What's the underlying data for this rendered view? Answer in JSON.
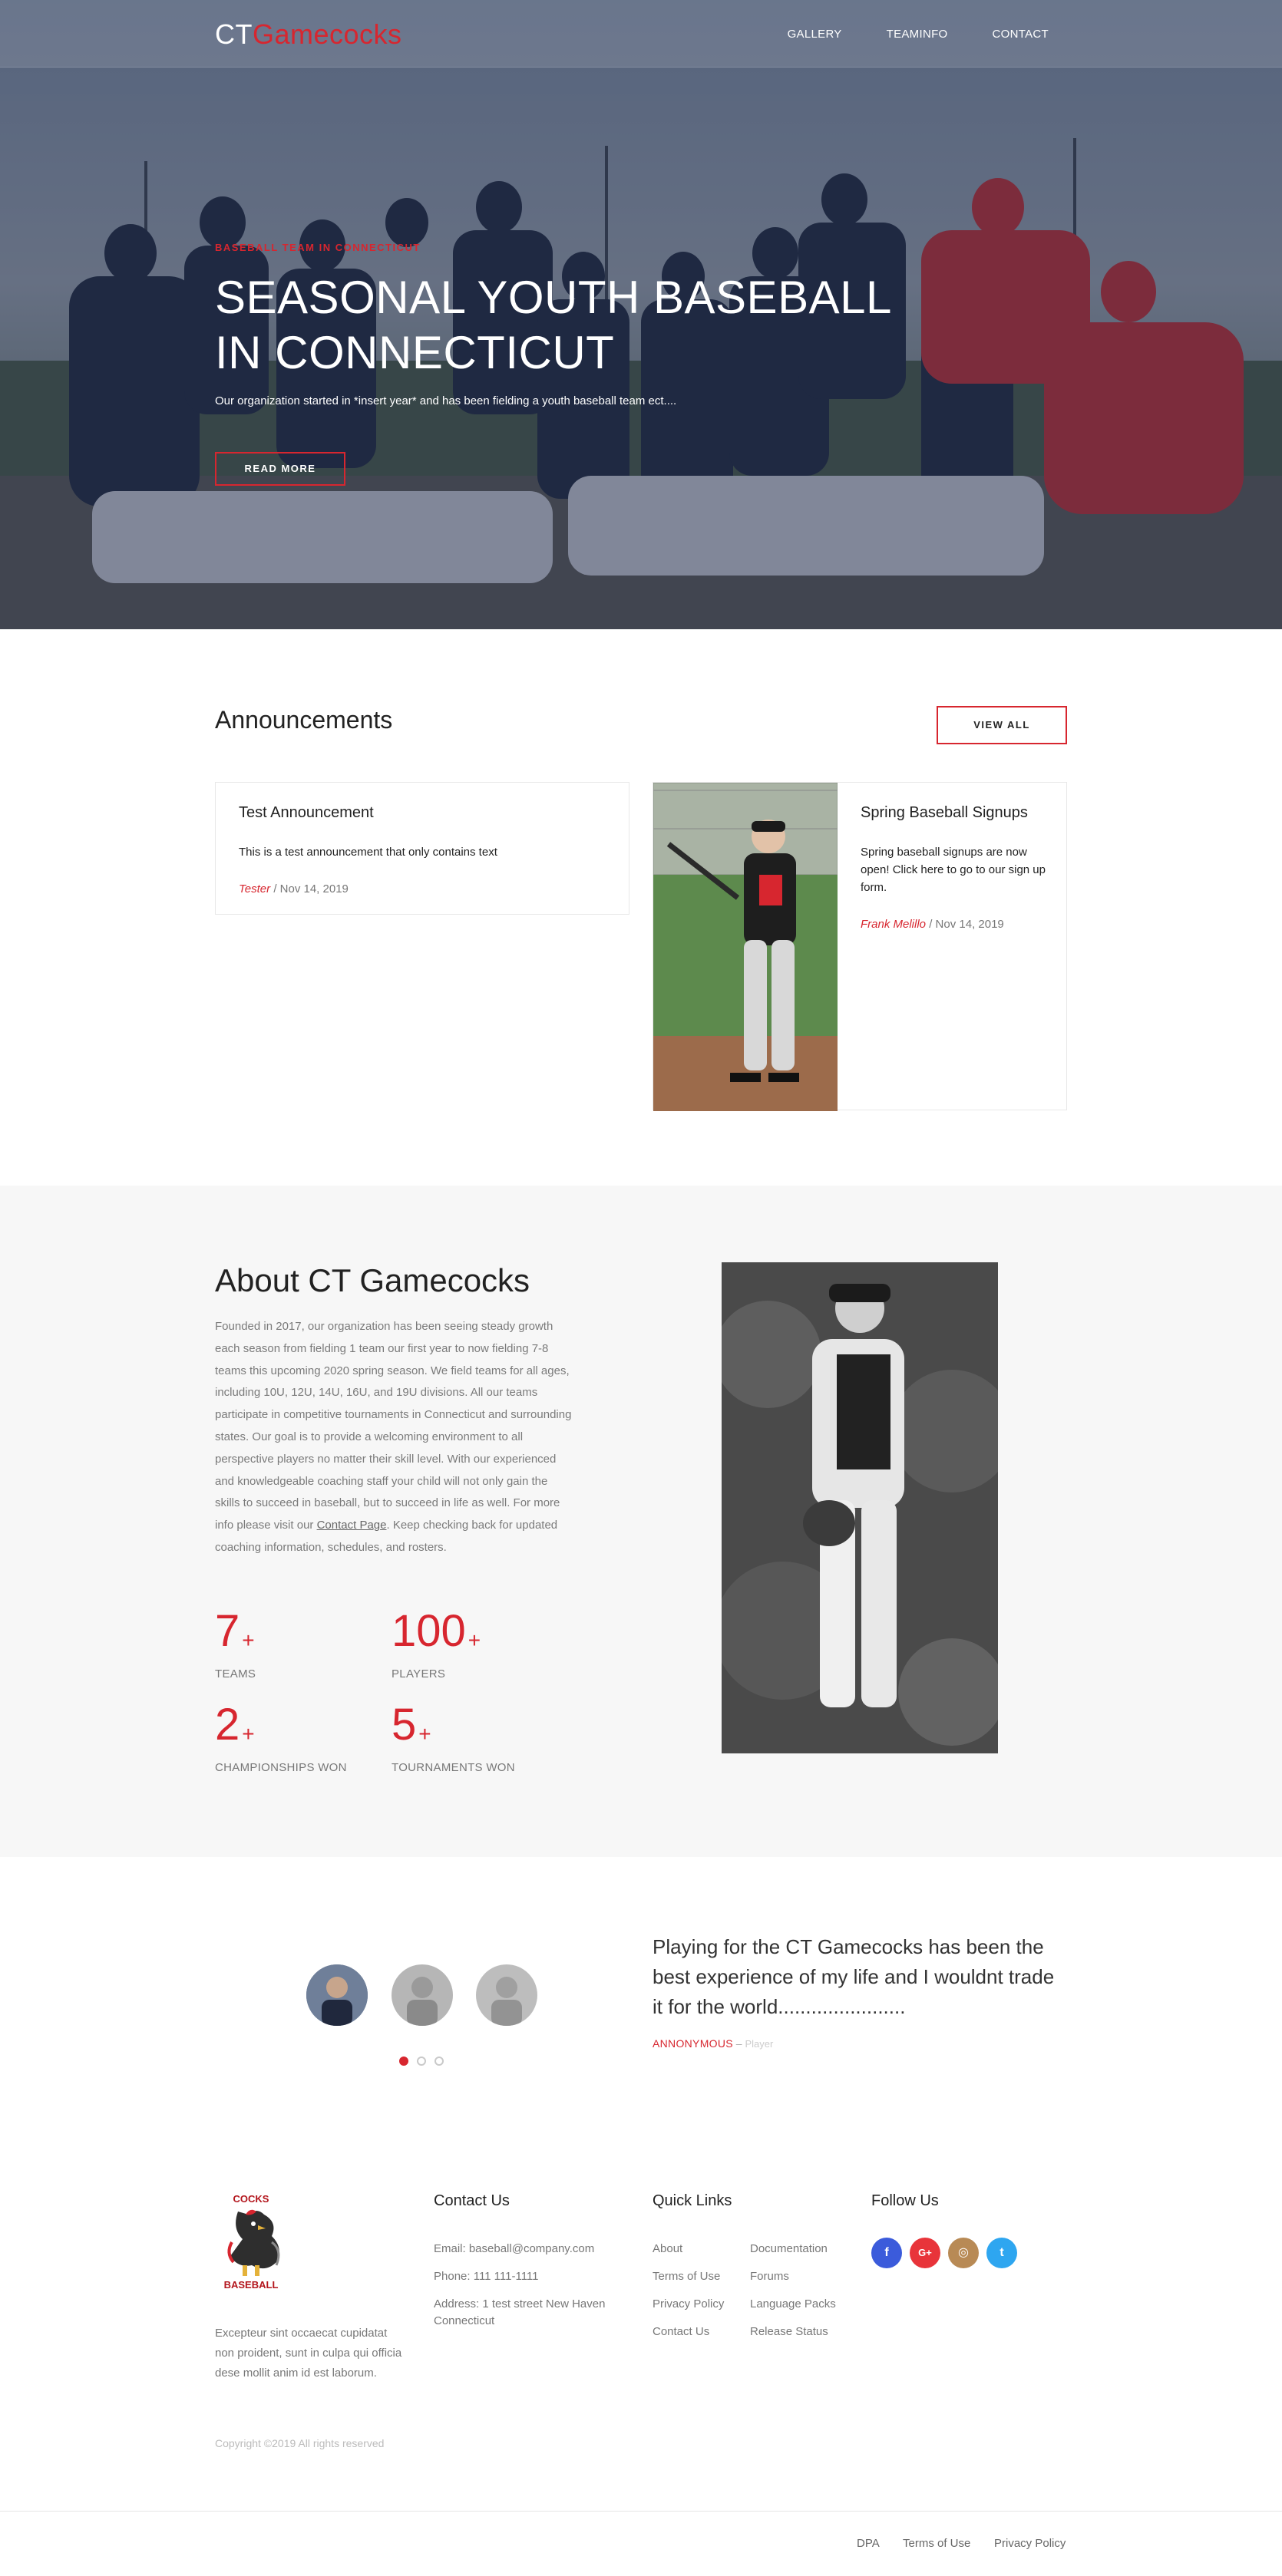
{
  "brand": {
    "part1": "CT",
    "part2": "Gamecocks"
  },
  "nav": {
    "items": [
      "GALLERY",
      "TEAMINFO",
      "CONTACT"
    ]
  },
  "hero": {
    "kicker": "BASEBALL TEAM IN CONNECTICUT",
    "title_line1": "SEASONAL YOUTH BASEBALL",
    "title_line2": "IN CONNECTICUT",
    "text": "Our organization started in *insert year* and has been fielding a youth baseball team ect....",
    "button": "READ MORE"
  },
  "announcements": {
    "title": "Announcements",
    "view_all": "VIEW ALL",
    "items": [
      {
        "title": "Test Announcement",
        "text": "This is a test announcement that only contains text",
        "author": "Tester",
        "date": "/ Nov 14, 2019"
      },
      {
        "title": "Spring Baseball Signups",
        "text": "Spring baseball signups are now open! Click here to go to our sign up form.",
        "author": "Frank Melillo",
        "date": "/ Nov 14, 2019"
      }
    ]
  },
  "about": {
    "title": "About CT Gamecocks",
    "text": "Founded in 2017, our organization has been seeing steady growth each season from fielding 1 team our first year to now fielding 7-8 teams this upcoming 2020 spring season. We field teams for all ages, including 10U, 12U, 14U, 16U, and 19U divisions. All our teams participate in competitive tournaments in Connecticut and surrounding states. Our goal is to provide a welcoming environment to all perspective players no matter their skill level. With our experienced and knowledgeable coaching staff your child will not only gain the skills to succeed in baseball, but to succeed in life as well. For more info please visit our",
    "link": "Contact Page",
    "text_after": ". Keep checking back for updated coaching information, schedules, and rosters.",
    "stats": [
      {
        "num": "7",
        "plus": "+",
        "label": "TEAMS"
      },
      {
        "num": "100",
        "plus": "+",
        "label": "PLAYERS"
      },
      {
        "num": "2",
        "plus": "+",
        "label": "CHAMPIONSHIPS WON"
      },
      {
        "num": "5",
        "plus": "+",
        "label": "TOURNAMENTS WON"
      }
    ]
  },
  "testimonial": {
    "quote": "Playing for the CT Gamecocks has been the best experience of my life and I wouldnt trade it for the world.......................",
    "author": "ANNONYMOUS",
    "dash": " – ",
    "role": "Player",
    "dots": 3,
    "active_dot": 0
  },
  "footer": {
    "logo_top": "COCKS",
    "logo_bottom": "BASEBALL",
    "about_text": "Excepteur sint occaecat cupidatat non proident, sunt in culpa qui officia dese mollit anim id est laborum.",
    "contact_title": "Contact Us",
    "email": "Email: baseball@company.com",
    "phone": "Phone: 111 111-1111",
    "address": "Address: 1 test street New Haven Connecticut",
    "quick_title": "Quick Links",
    "quick_col1": [
      "About",
      "Terms of Use",
      "Privacy Policy",
      "Contact Us"
    ],
    "quick_col2": [
      "Documentation",
      "Forums",
      "Language Packs",
      "Release Status"
    ],
    "follow_title": "Follow Us",
    "social": [
      {
        "icon": "facebook-icon",
        "glyph": "f",
        "color": "#3b5bdb"
      },
      {
        "icon": "google-plus-icon",
        "glyph": "G+",
        "color": "#e8343a"
      },
      {
        "icon": "instagram-icon",
        "glyph": "◎",
        "color": "#b88a55"
      },
      {
        "icon": "twitter-icon",
        "glyph": "t",
        "color": "#2ea6f0"
      }
    ],
    "copyright": "Copyright ©2019 All rights reserved",
    "bottom_links": [
      "DPA",
      "Terms of Use",
      "Privacy Policy"
    ]
  },
  "colors": {
    "accent": "#d7262f",
    "about_bg": "#f7f7f7"
  }
}
